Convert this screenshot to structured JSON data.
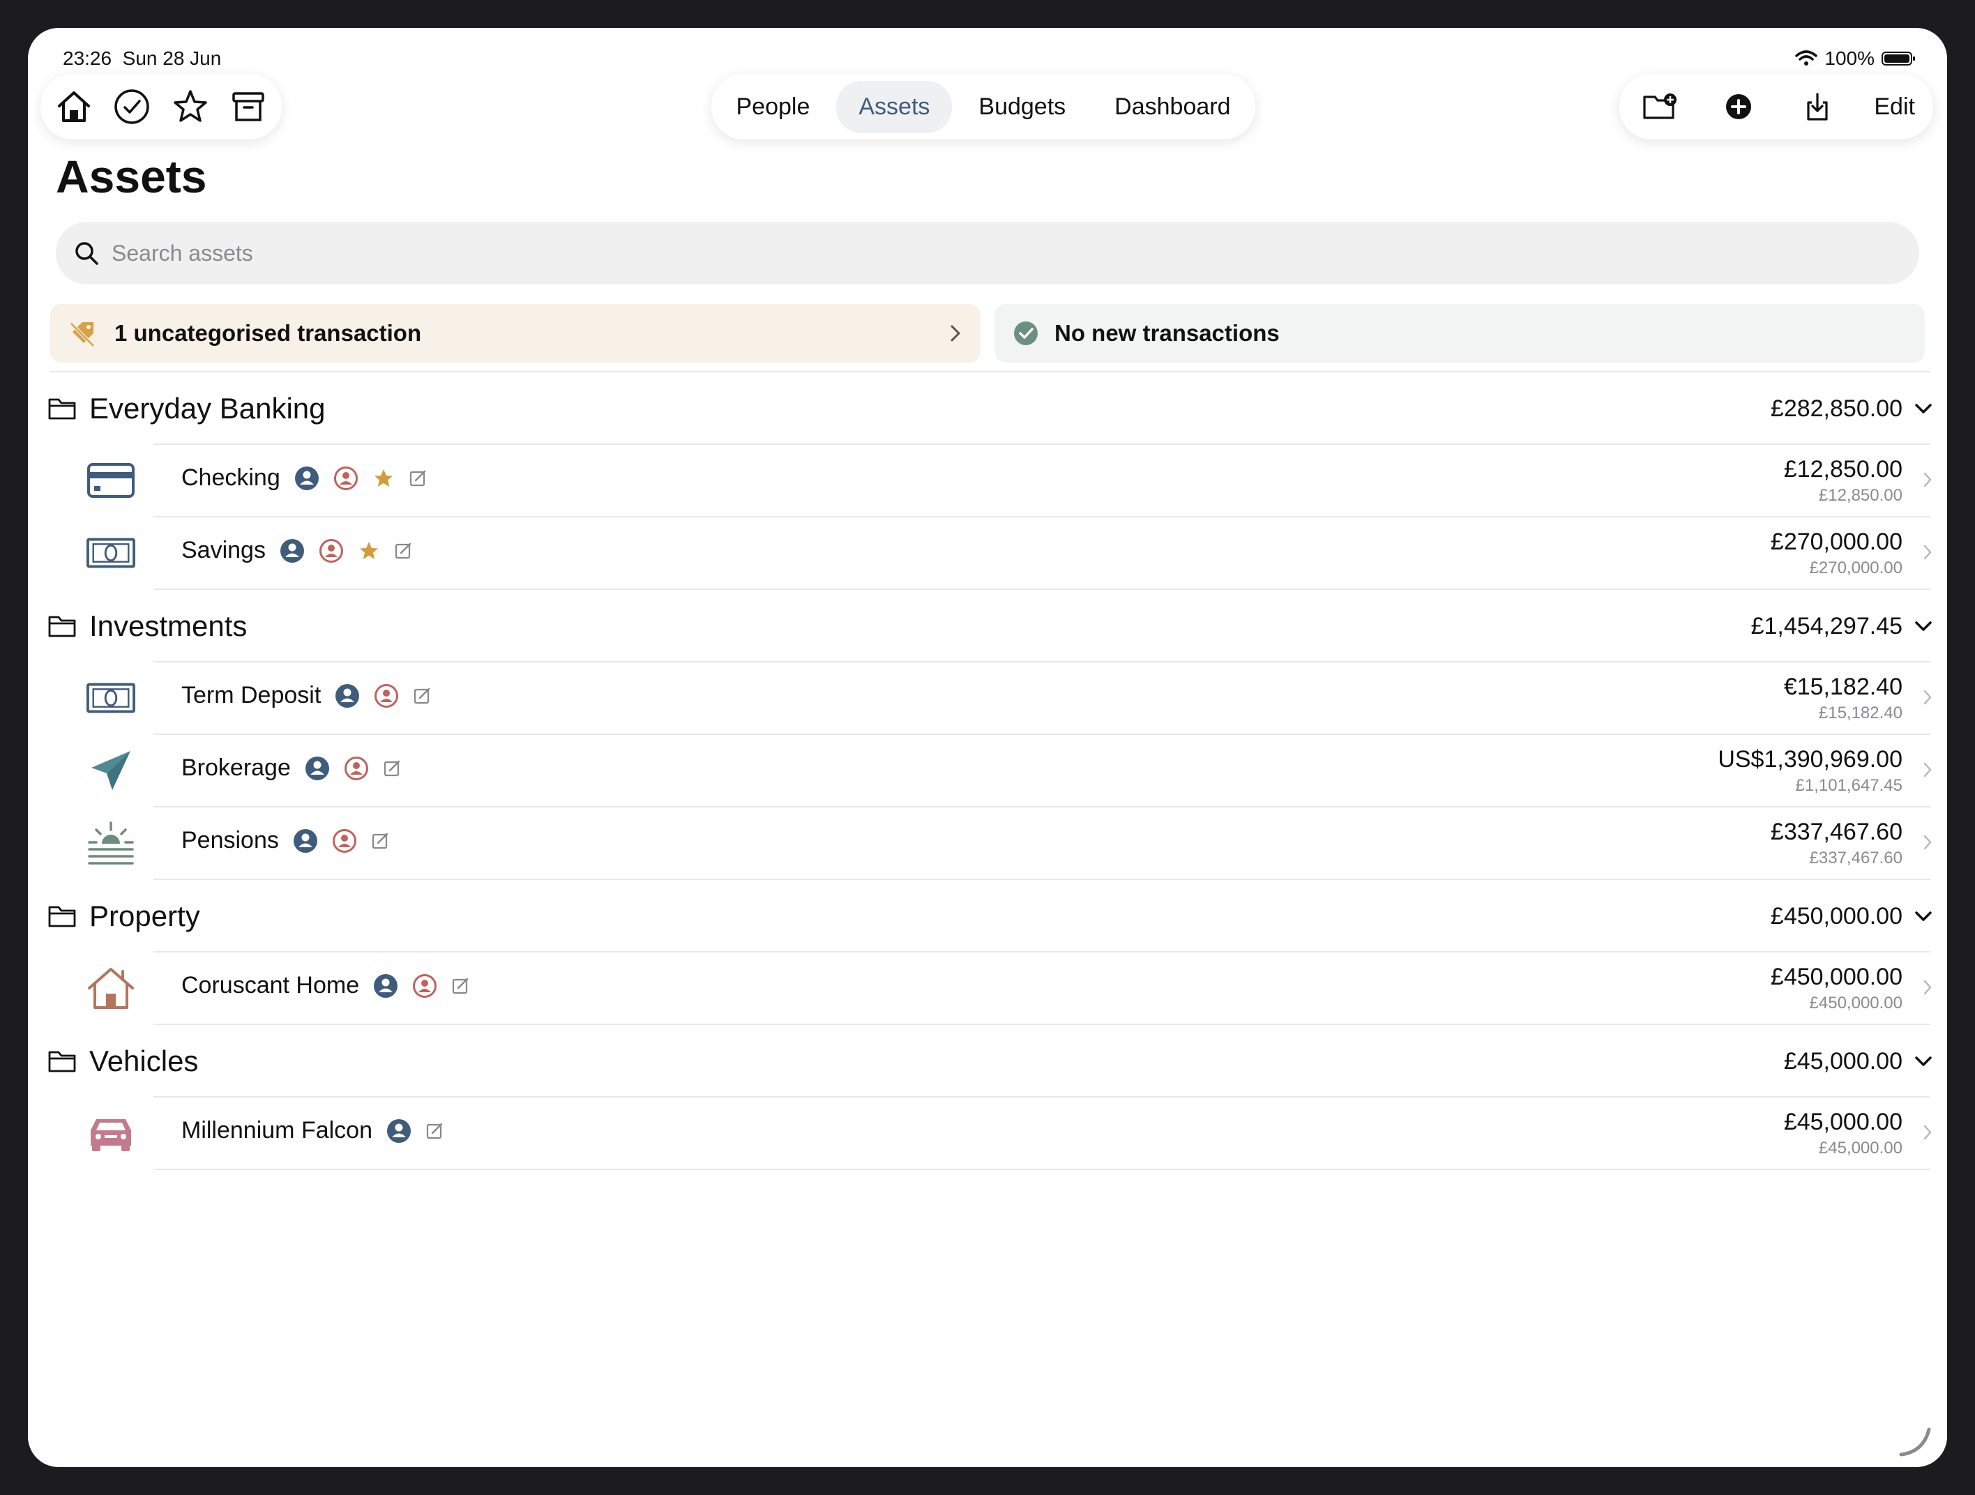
{
  "status": {
    "time": "23:26",
    "date": "Sun 28 Jun",
    "battery": "100%"
  },
  "left_toolbar": {
    "icons": [
      "home-icon",
      "checkmark-circle-icon",
      "star-icon",
      "archive-box-icon"
    ]
  },
  "tabs": [
    {
      "label": "People",
      "active": false
    },
    {
      "label": "Assets",
      "active": true
    },
    {
      "label": "Budgets",
      "active": false
    },
    {
      "label": "Dashboard",
      "active": false
    }
  ],
  "right_toolbar": {
    "icons": [
      "folder-add-icon",
      "plus-circle-icon",
      "share-download-icon"
    ],
    "edit_label": "Edit"
  },
  "page_title": "Assets",
  "search": {
    "placeholder": "Search assets",
    "value": ""
  },
  "banners": {
    "uncategorised": "1 uncategorised transaction",
    "no_new": "No new transactions"
  },
  "colors": {
    "accent_blue": "#3f5c7c",
    "person_red": "#c0625c",
    "star_gold": "#d39b3a",
    "teal": "#4f8a95",
    "car_pink": "#c47a8c",
    "house_brown": "#b2765e",
    "pension_green": "#6c8c7d"
  },
  "groups": [
    {
      "name": "Everyday Banking",
      "total": "£282,850.00",
      "items": [
        {
          "name": "Checking",
          "icon": "credit-card-icon",
          "owners": [
            "person-filled",
            "person-outline"
          ],
          "star": true,
          "amount": "£12,850.00",
          "converted": "£12,850.00"
        },
        {
          "name": "Savings",
          "icon": "banknote-icon",
          "owners": [
            "person-filled",
            "person-outline"
          ],
          "star": true,
          "amount": "£270,000.00",
          "converted": "£270,000.00"
        }
      ]
    },
    {
      "name": "Investments",
      "total": "£1,454,297.45",
      "items": [
        {
          "name": "Term Deposit",
          "icon": "banknote-icon",
          "owners": [
            "person-filled",
            "person-outline"
          ],
          "star": false,
          "amount": "€15,182.40",
          "converted": "£15,182.40"
        },
        {
          "name": "Brokerage",
          "icon": "paper-plane-icon",
          "owners": [
            "person-filled",
            "person-outline"
          ],
          "star": false,
          "amount": "US$1,390,969.00",
          "converted": "£1,101,647.45"
        },
        {
          "name": "Pensions",
          "icon": "sunrise-icon",
          "owners": [
            "person-filled",
            "person-outline"
          ],
          "star": false,
          "amount": "£337,467.60",
          "converted": "£337,467.60"
        }
      ]
    },
    {
      "name": "Property",
      "total": "£450,000.00",
      "items": [
        {
          "name": "Coruscant Home",
          "icon": "house-icon",
          "owners": [
            "person-filled",
            "person-outline"
          ],
          "star": false,
          "amount": "£450,000.00",
          "converted": "£450,000.00"
        }
      ]
    },
    {
      "name": "Vehicles",
      "total": "£45,000.00",
      "items": [
        {
          "name": "Millennium Falcon",
          "icon": "car-icon",
          "owners": [
            "person-filled"
          ],
          "star": false,
          "amount": "£45,000.00",
          "converted": "£45,000.00"
        }
      ]
    }
  ]
}
